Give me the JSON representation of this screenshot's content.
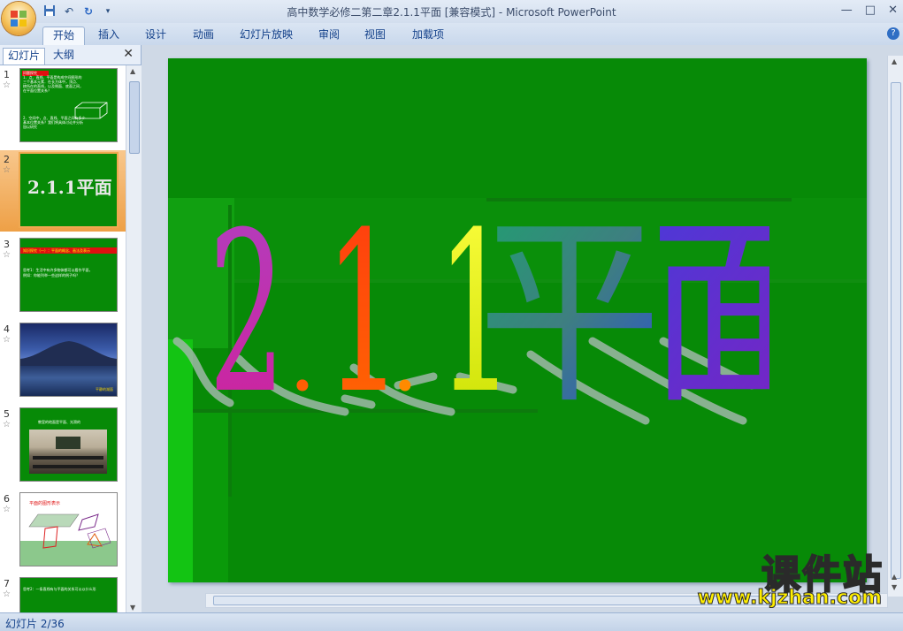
{
  "window": {
    "title": "高中数学必修二第二章2.1.1平面 [兼容模式] - Microsoft PowerPoint",
    "controls": [
      "—",
      "□",
      "✕"
    ]
  },
  "qat": {
    "save_icon": "save-icon",
    "undo_icon": "undo-icon",
    "redo_icon": "redo-icon",
    "customize_icon": "dropdown-icon"
  },
  "ribbon": {
    "tabs": [
      {
        "label": "开始",
        "active": true
      },
      {
        "label": "插入"
      },
      {
        "label": "设计"
      },
      {
        "label": "动画"
      },
      {
        "label": "幻灯片放映"
      },
      {
        "label": "审阅"
      },
      {
        "label": "视图"
      },
      {
        "label": "加载项"
      }
    ]
  },
  "left_pane": {
    "tabs": [
      {
        "label": "幻灯片",
        "active": true
      },
      {
        "label": "大纲"
      }
    ],
    "close": "✕",
    "star": "☆",
    "thumbnails": [
      {
        "num": "1",
        "lines": [
          "问题探究",
          "1．点、直线、平面是构成空间图形的",
          "三个基本元素．在长方体中，顶点、",
          "棱所在的直线，以及侧面、底面之间，",
          "在平面位置关系？",
          "2．空间中，点、直线、平面之间有多少",
          "基本位置关系？我们将具体讨论并分析",
          "加以研究"
        ]
      },
      {
        "num": "2",
        "title": "2.1.1平面"
      },
      {
        "num": "3",
        "lines": [
          "知识探究（一）：平面的概念、画法及表示",
          "思考1：生活中有许多物体都可以看作平面，",
          "例如：你能列举一些这样的例子吗？"
        ]
      },
      {
        "num": "4",
        "caption": "平静的湖面"
      },
      {
        "num": "5",
        "caption": "教室的地面是平面、光滑的"
      },
      {
        "num": "6",
        "caption": "平面的图形表示"
      },
      {
        "num": "7",
        "lines": [
          "思考2：一条直线有与平面的关系可以以什么形"
        ]
      }
    ]
  },
  "slide": {
    "title": "2.1.1平面"
  },
  "status": {
    "text": "幻灯片 2/36"
  },
  "watermark": {
    "cn": "课件站",
    "en": "www.kjzhan.com"
  }
}
